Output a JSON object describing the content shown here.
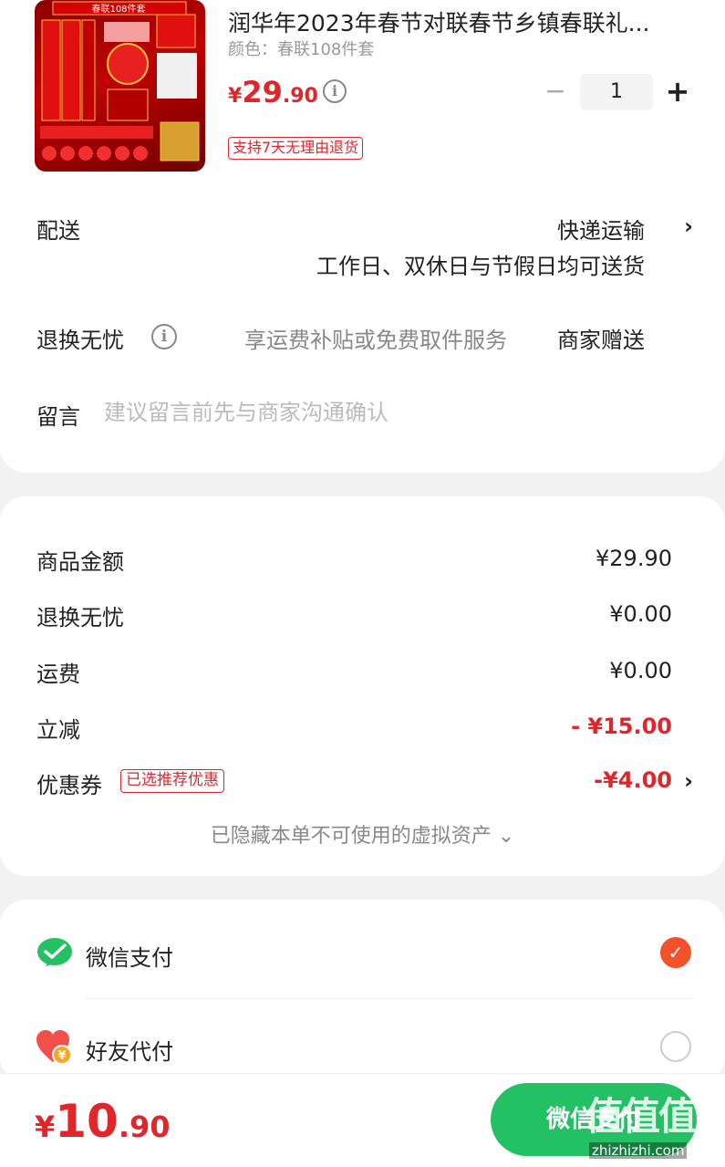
{
  "product": {
    "title": "润华年2023年春节对联春节乡镇春联礼...",
    "variant": "颜色：春联108件套",
    "price_symbol": "¥",
    "price_int": "29",
    "price_dec": ".90",
    "quantity": "1",
    "return_badge": "支持7天无理由退货",
    "image_banner": "春联108件套"
  },
  "shipping": {
    "label": "配送",
    "method": "快递运输",
    "desc": "工作日、双休日与节假日均可送货"
  },
  "worry_free": {
    "label": "退换无忧",
    "desc": "享运费补贴或免费取件服务",
    "gift": "商家赠送"
  },
  "message": {
    "label": "留言",
    "placeholder": "建议留言前先与商家沟通确认"
  },
  "summary": {
    "goods_label": "商品金额",
    "goods_value": "¥29.90",
    "worry_label": "退换无忧",
    "worry_value": "¥0.00",
    "freight_label": "运费",
    "freight_value": "¥0.00",
    "discount_label": "立减",
    "discount_value": "- ¥15.00",
    "coupon_label": "优惠券",
    "coupon_badge": "已选推荐优惠",
    "coupon_value": "-¥4.00",
    "hidden_note": "已隐藏本单不可使用的虚拟资产 ⌄"
  },
  "payment": {
    "wechat_label": "微信支付",
    "friend_label": "好友代付"
  },
  "footer": {
    "total_symbol": "¥",
    "total_int": "10",
    "total_dec": ".90",
    "pay_button": "微信支付",
    "watermark": "值值值",
    "watermark_url": "zhizhizhi.com"
  },
  "colors": {
    "accent_red": "#e0262b",
    "wechat_green": "#23c163",
    "check_orange": "#f1522a"
  }
}
